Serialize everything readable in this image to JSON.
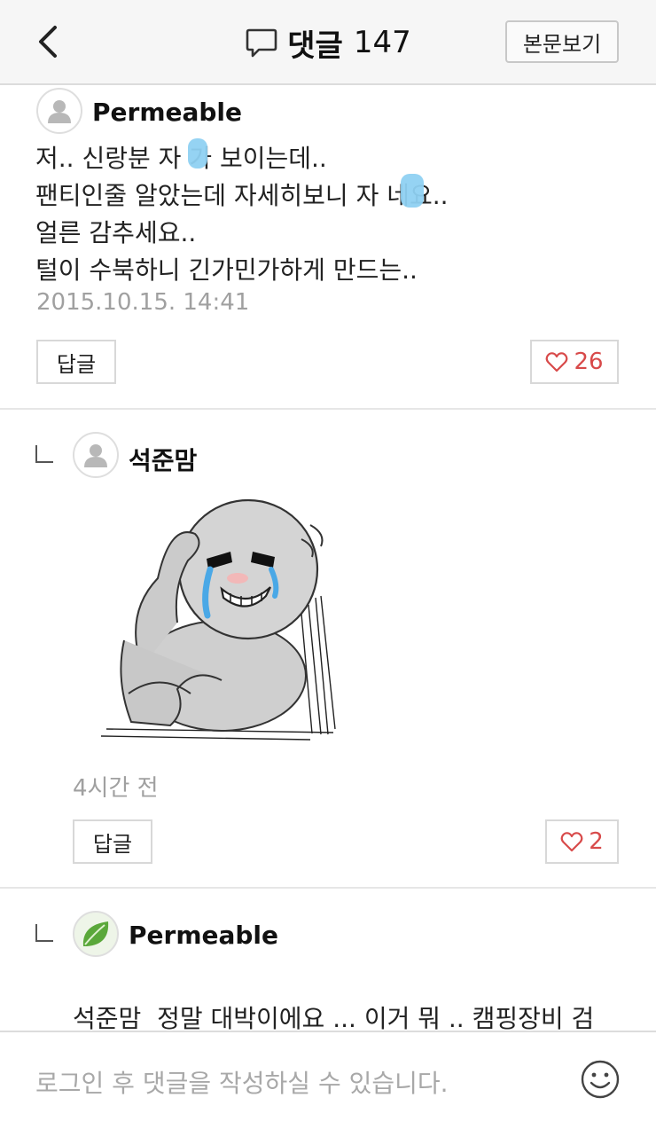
{
  "header": {
    "title": "댓글",
    "count": "147",
    "view_button": "본문보기"
  },
  "comments": [
    {
      "author": "Permeable",
      "body": "저.. 신랑분 자  가 보이는데..\n팬티인줄 알았는데 자세히보니 자  네요..\n얼른 감추세요..\n털이 수북하니 긴가민가하게 만드는..",
      "timestamp": "2015.10.15. 14:41",
      "reply_label": "답글",
      "likes": "26"
    },
    {
      "author": "석준맘",
      "timestamp": "4시간 전",
      "reply_label": "답글",
      "likes": "2"
    },
    {
      "author": "Permeable",
      "mention": "석준맘",
      "body": "정말 대박이에요 ... 이거 뭐 .. 캠핑장비 검\n색하다가 눈이 휘둥그레 졌네요 ㅎㅎ"
    }
  ],
  "input": {
    "placeholder": "로그인 후 댓글을 작성하실 수 있습니다."
  },
  "colors": {
    "accent_like": "#d84a4a",
    "header_bg": "#f6f6f6",
    "censor_blur": "#8fd1f2"
  },
  "icons": [
    "back-arrow-icon",
    "speech-bubble-icon",
    "person-icon",
    "heart-icon",
    "leaf-icon",
    "smiley-icon"
  ]
}
